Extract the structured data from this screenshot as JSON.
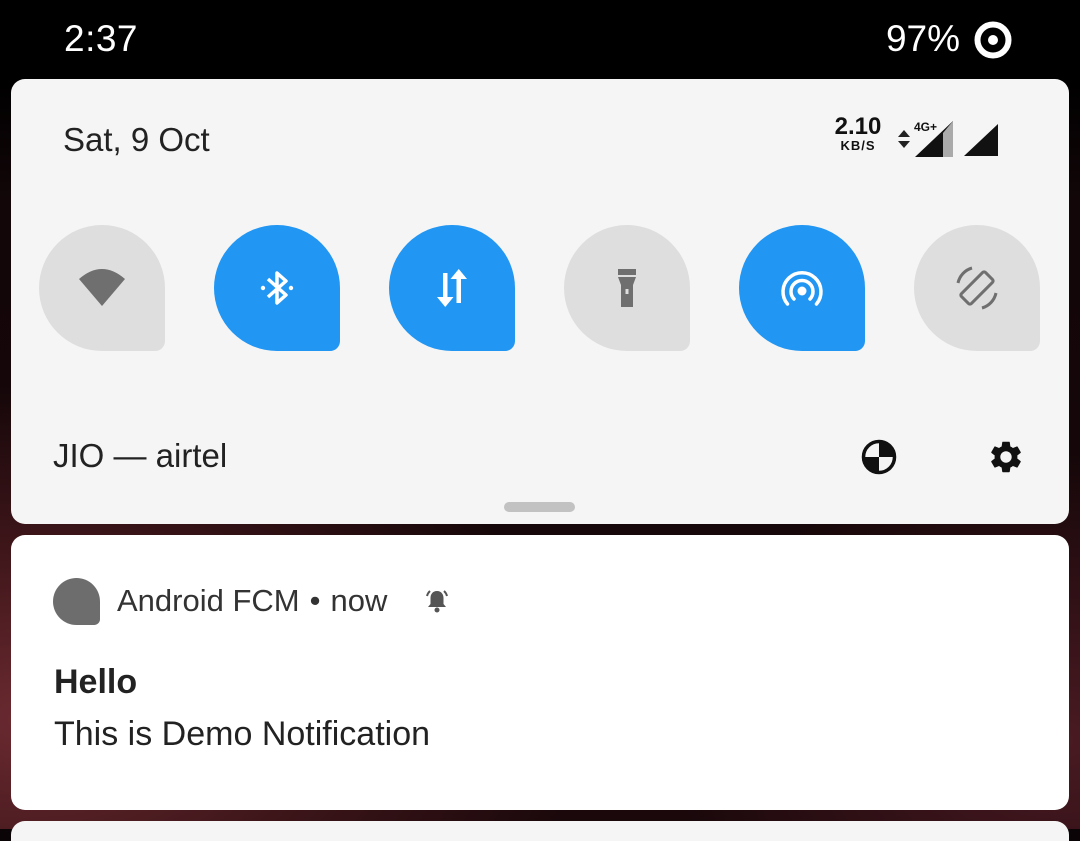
{
  "status_bar": {
    "time": "2:37",
    "battery": "97%",
    "battery_icon": "battery-ring-icon"
  },
  "quick_settings": {
    "date": "Sat, 9 Oct",
    "network_speed": {
      "value": "2.10",
      "unit": "KB/S"
    },
    "network_type": "4G+",
    "tiles": [
      {
        "name": "wifi",
        "icon": "wifi-icon",
        "active": false
      },
      {
        "name": "bluetooth",
        "icon": "bluetooth-icon",
        "active": true
      },
      {
        "name": "mobile-data",
        "icon": "mobile-data-icon",
        "active": true
      },
      {
        "name": "flashlight",
        "icon": "flashlight-icon",
        "active": false
      },
      {
        "name": "hotspot",
        "icon": "hotspot-icon",
        "active": true
      },
      {
        "name": "auto-rotate",
        "icon": "auto-rotate-icon",
        "active": false
      }
    ],
    "carrier": "JIO — airtel",
    "colors": {
      "active_tile": "#2196f3",
      "inactive_tile": "#dedede",
      "panel": "#f5f5f5"
    }
  },
  "notification": {
    "app_name": "Android FCM",
    "separator": "•",
    "time": "now",
    "title": "Hello",
    "text": "This is Demo Notification"
  }
}
